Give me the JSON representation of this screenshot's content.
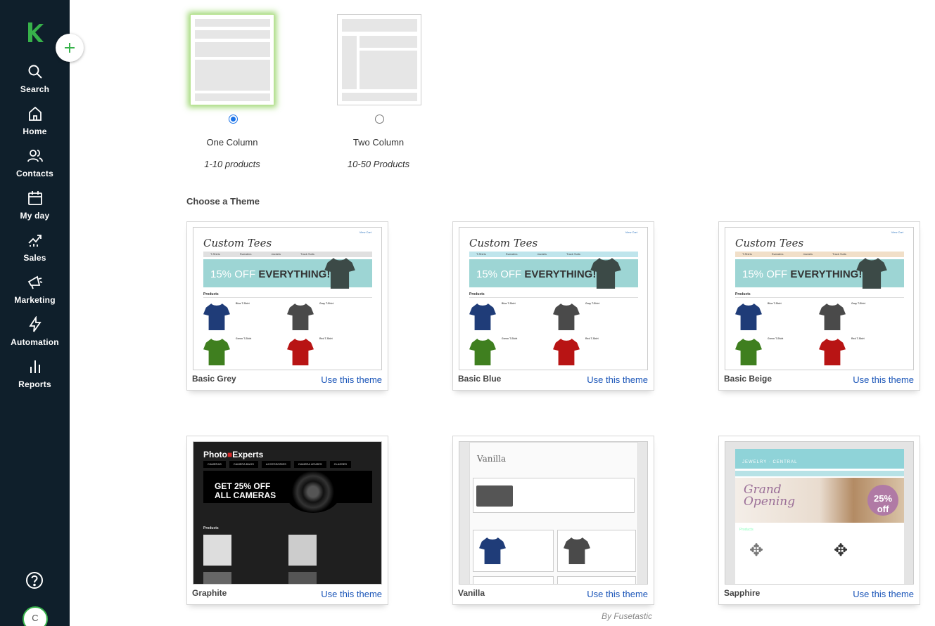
{
  "sidebar": {
    "logo": "k-logo",
    "add_button": "plus-icon",
    "items": [
      {
        "label": "Search",
        "icon": "search-icon"
      },
      {
        "label": "Home",
        "icon": "home-icon"
      },
      {
        "label": "Contacts",
        "icon": "contacts-icon"
      },
      {
        "label": "My day",
        "icon": "calendar-icon"
      },
      {
        "label": "Sales",
        "icon": "sales-icon"
      },
      {
        "label": "Marketing",
        "icon": "megaphone-icon"
      },
      {
        "label": "Automation",
        "icon": "lightning-icon"
      },
      {
        "label": "Reports",
        "icon": "bar-chart-icon"
      }
    ],
    "help_icon": "help-icon",
    "avatar_initial": "C"
  },
  "layouts": [
    {
      "name": "One Column",
      "desc": "1-10 products",
      "selected": true
    },
    {
      "name": "Two Column",
      "desc": "10-50 Products",
      "selected": false
    }
  ],
  "themes_title": "Choose a Theme",
  "use_label": "Use this theme",
  "themes": [
    {
      "name": "Basic Grey",
      "accent": "#e0e0e0"
    },
    {
      "name": "Basic Blue",
      "accent": "#bfe5ec"
    },
    {
      "name": "Basic Beige",
      "accent": "#f1dfc8"
    },
    {
      "name": "Graphite"
    },
    {
      "name": "Vanilla"
    },
    {
      "name": "Sapphire"
    }
  ],
  "thumb_text": {
    "tee_title": "Custom Tees",
    "tee_cart": "View Cart",
    "tee_nav": [
      "T-Shirts",
      "Sweaters",
      "Jackets",
      "Track Suits"
    ],
    "tee_banner_light": "15% OFF ",
    "tee_banner_bold": "EVERYTHING!",
    "tee_products": "Products",
    "tee_items": [
      "Blue T-Shirt",
      "Gray T-Shirt",
      "Green T-Shirt",
      "Red T-Shirt"
    ],
    "graphite_title_a": "Photo",
    "graphite_title_b": "Experts",
    "graphite_nav": [
      "CAMERAS",
      "CAMERA BAGS",
      "ACCESSORIES",
      "CAMERA LENSES",
      "CLASSES"
    ],
    "graphite_banner": "GET 25% OFF ALL CAMERAS",
    "vanilla_title": "Vanilla",
    "sapphire_title": "JEWELRY · CENTRAL",
    "sapphire_grand": "Grand Opening",
    "sapphire_badge": "25% off"
  },
  "credit": "By Fusetastic"
}
